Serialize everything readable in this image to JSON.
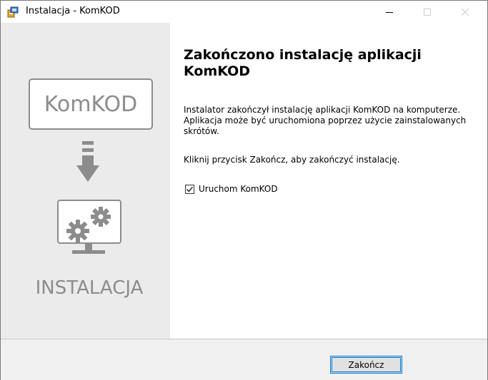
{
  "window": {
    "title": "Instalacja - KomKOD",
    "controls": {
      "minimize_icon": "minimize-icon",
      "maximize_icon": "maximize-icon",
      "close_icon": "close-icon"
    }
  },
  "sidebar": {
    "logo_text": "KomKOD",
    "caption": "INSTALACJA",
    "icons": [
      "down-arrow-icon",
      "gears-monitor-icon"
    ]
  },
  "main": {
    "heading": "Zakończono instalację aplikacji KomKOD",
    "paragraph1": "Instalator zakończył instalację aplikacji KomKOD na komputerze. Aplikacja może być uruchomiona poprzez użycie zainstalowanych skrótów.",
    "paragraph2": "Kliknij przycisk Zakończ, aby zakończyć instalację.",
    "checkbox": {
      "label": "Uruchom KomKOD",
      "checked": true
    }
  },
  "footer": {
    "finish_label": "Zakończ"
  },
  "colors": {
    "accent": "#0078d7",
    "sidebar_bg": "#ebebeb",
    "sidebar_fg": "#8c8c8c"
  }
}
